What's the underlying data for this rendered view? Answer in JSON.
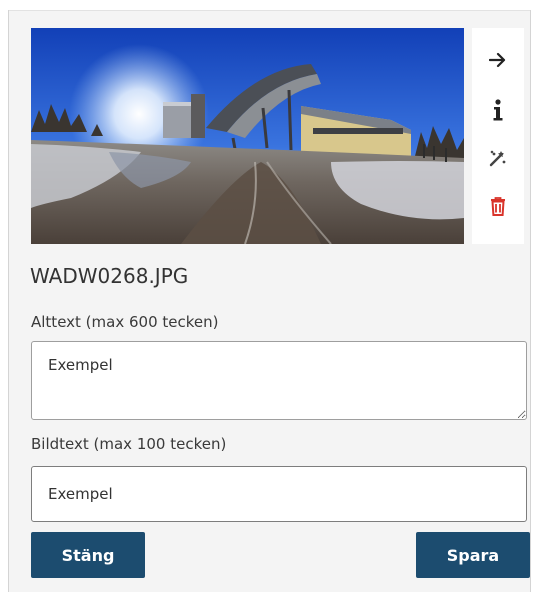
{
  "image": {
    "file_name": "WADW0268.JPG"
  },
  "tools": [
    {
      "icon": "arrow-right-icon",
      "color": "#222222"
    },
    {
      "icon": "info-icon",
      "color": "#222222"
    },
    {
      "icon": "magic-wand-icon",
      "color": "#444444"
    },
    {
      "icon": "trash-icon",
      "color": "#d9342b"
    }
  ],
  "alt_text": {
    "label": "Alttext (max 600 tecken)",
    "value": "Exempel"
  },
  "caption": {
    "label": "Bildtext (max 100 tecken)",
    "value": "Exempel"
  },
  "buttons": {
    "close_label": "Stäng",
    "save_label": "Spara"
  },
  "colors": {
    "button_bg": "#1c4c6f",
    "panel_bg": "#f4f4f4",
    "delete_red": "#d9342b"
  }
}
